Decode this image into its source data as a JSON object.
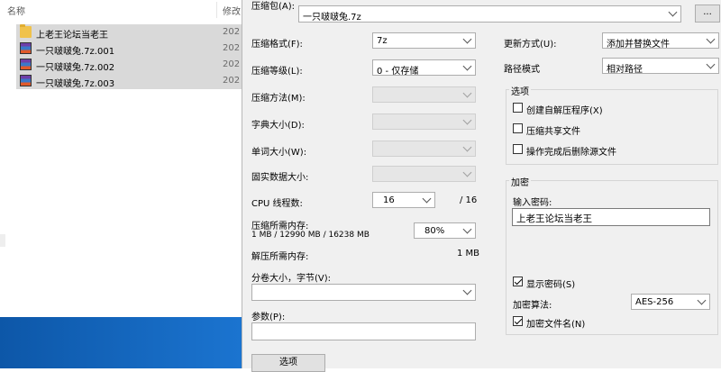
{
  "explorer": {
    "col_name": "名称",
    "col_date": "修改",
    "files": [
      {
        "name": "上老王论坛当老王",
        "date": "202",
        "icon": "folder-icon"
      },
      {
        "name": "一只啵啵兔.7z.001",
        "date": "202",
        "icon": "archive-icon"
      },
      {
        "name": "一只啵啵兔.7z.002",
        "date": "202",
        "icon": "archive-icon"
      },
      {
        "name": "一只啵啵兔.7z.003",
        "date": "202",
        "icon": "archive-icon"
      }
    ]
  },
  "dialog": {
    "archive_label": "压缩包(A):",
    "archive_path": "一只啵啵兔.7z",
    "browse_label": "...",
    "format_label": "压缩格式(F):",
    "format_value": "7z",
    "level_label": "压缩等级(L):",
    "level_value": "0 - 仅存储",
    "method_label": "压缩方法(M):",
    "dict_label": "字典大小(D):",
    "word_label": "单词大小(W):",
    "solid_label": "固实数据大小:",
    "cpu_label": "CPU 线程数:",
    "cpu_value": "16",
    "cpu_total": "/ 16",
    "mem_label": "压缩所需内存:",
    "mem_detail": "1 MB / 12990 MB / 16238 MB",
    "mem_percent": "80%",
    "decomp_label": "解压所需内存:",
    "decomp_value": "1 MB",
    "volume_label": "分卷大小，字节(V):",
    "volume_value": "",
    "params_label": "参数(P):",
    "params_value": "",
    "options_button": "选项",
    "update_label": "更新方式(U):",
    "update_value": "添加并替换文件",
    "path_label": "路径模式",
    "path_value": "相对路径",
    "options_group": "选项",
    "opt_sfx": "创建自解压程序(X)",
    "opt_shared": "压缩共享文件",
    "opt_delete": "操作完成后删除源文件",
    "enc_group": "加密",
    "password_label": "输入密码:",
    "password_value": "上老王论坛当老王",
    "show_password": "显示密码(S)",
    "enc_method_label": "加密算法:",
    "enc_method_value": "AES-256",
    "enc_names": "加密文件名(N)"
  },
  "colors": {
    "taskbar": "#1060b8",
    "dialog_bg": "#f0f0f0"
  }
}
